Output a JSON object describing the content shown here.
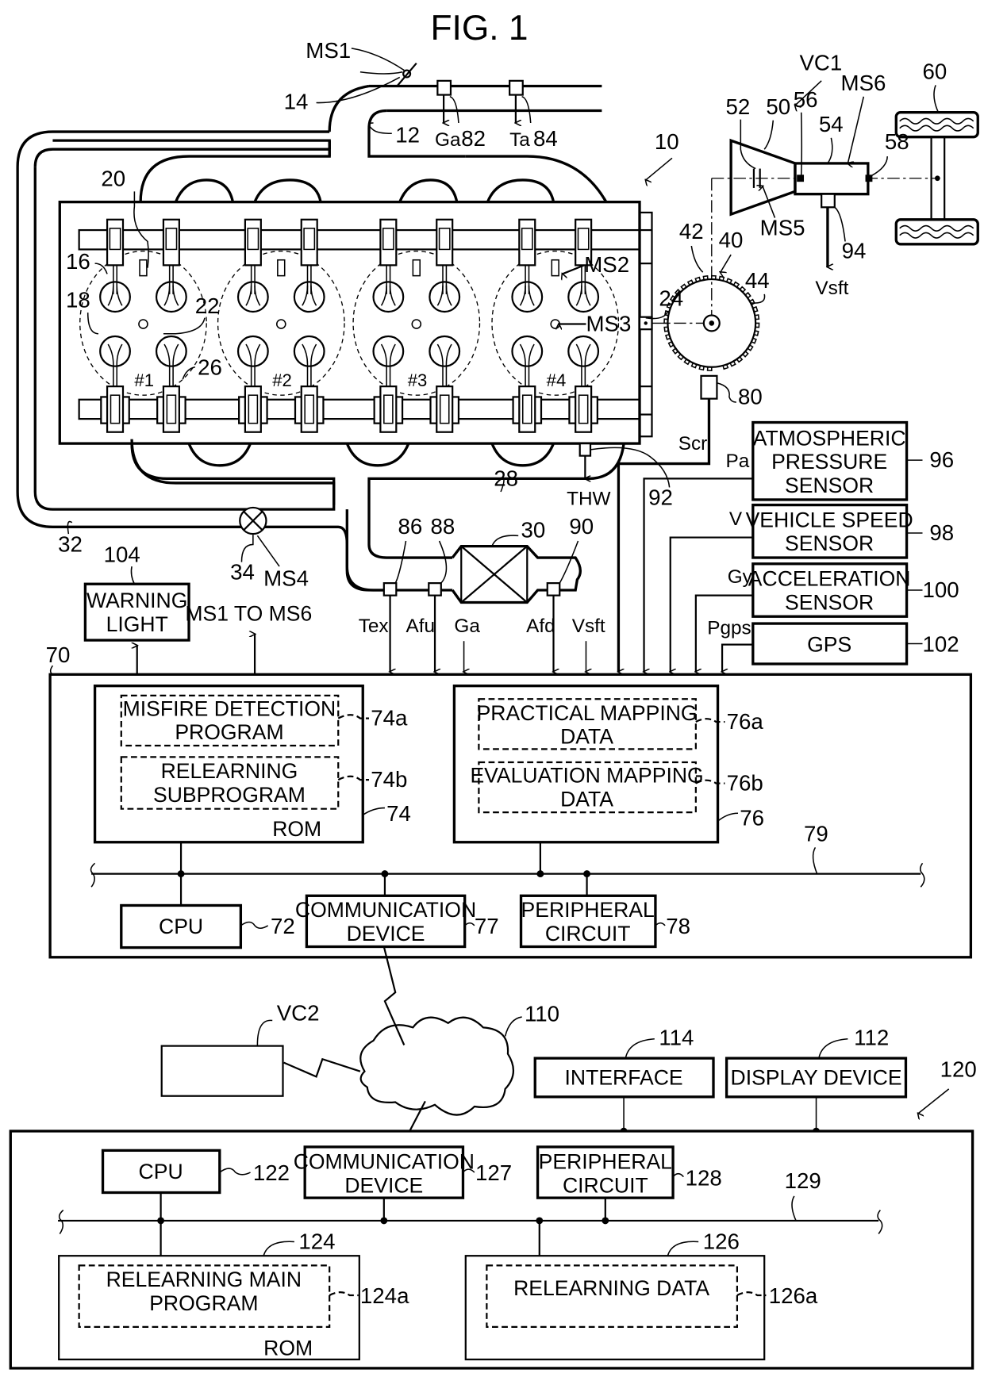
{
  "figure": {
    "title": "FIG. 1"
  },
  "engine": {
    "ref_vehicle": "VC1",
    "ref_engine": "10",
    "ref_intake": "12",
    "ref_throttle": "14",
    "ref_fuel_injector": "16",
    "ref_cylinder": "18",
    "ref_intake_valve": "20",
    "ref_ignition": "22",
    "ref_crankshaft": "24",
    "ref_exhaust_valve": "26",
    "ref_exhaust": "28",
    "ref_catalyst": "30",
    "ref_egr_passage": "32",
    "ref_egr_valve": "34",
    "cylinders": [
      "#1",
      "#2",
      "#3",
      "#4"
    ],
    "ms1": "MS1",
    "ms2": "MS2",
    "ms3": "MS3",
    "ms4": "MS4",
    "ms5": "MS5",
    "ms6": "MS6"
  },
  "drivetrain": {
    "ref_crank_rotor": "40",
    "ref_teeth": "42",
    "ref_missing_tooth": "44",
    "ref_torque_converter": "50",
    "ref_lockup_clutch": "52",
    "ref_transmission": "54",
    "ref_input_shaft": "56",
    "ref_output_shaft": "58",
    "ref_wheels": "60"
  },
  "sensors": {
    "ref_crank_sensor": "80",
    "signal_crank": "Scr",
    "ref_airflow": "82",
    "signal_airflow": "Ga",
    "ref_intake_temp": "84",
    "signal_intake_temp": "Ta",
    "ref_exhaust_temp": "86",
    "signal_exhaust_temp": "Tex",
    "ref_upstream_af": "88",
    "signal_upstream_af": "Afu",
    "ref_downstream_af": "90",
    "signal_downstream_af": "Afd",
    "ref_coolant": "92",
    "signal_coolant": "THW",
    "ref_shaft_speed": "94",
    "signal_shaft_speed": "Vsft",
    "atmospheric": {
      "label_1": "ATMOSPHERIC",
      "label_2": "PRESSURE",
      "label_3": "SENSOR",
      "ref": "96",
      "signal": "Pa"
    },
    "vehicle_speed": {
      "label_1": "VEHICLE SPEED",
      "label_2": "SENSOR",
      "ref": "98",
      "signal": "V"
    },
    "acceleration": {
      "label_1": "ACCELERATION",
      "label_2": "SENSOR",
      "ref": "100",
      "signal": "Gy"
    },
    "gps": {
      "label": "GPS",
      "ref": "102",
      "signal": "Pgps"
    }
  },
  "warning_light": {
    "label_1": "WARNING",
    "label_2": "LIGHT",
    "ref": "104"
  },
  "ecu": {
    "ref": "70",
    "outputs_label": "MS1 TO MS6",
    "cpu": {
      "label": "CPU",
      "ref": "72"
    },
    "rom": {
      "label": "ROM",
      "ref": "74",
      "misfire": {
        "label_1": "MISFIRE DETECTION",
        "label_2": "PROGRAM",
        "ref": "74a"
      },
      "relearn_sub": {
        "label_1": "RELEARNING",
        "label_2": "SUBPROGRAM",
        "ref": "74b"
      }
    },
    "storage": {
      "ref": "76",
      "practical": {
        "label_1": "PRACTICAL MAPPING",
        "label_2": "DATA",
        "ref": "76a"
      },
      "evaluation": {
        "label_1": "EVALUATION MAPPING",
        "label_2": "DATA",
        "ref": "76b"
      }
    },
    "comm": {
      "label_1": "COMMUNICATION",
      "label_2": "DEVICE",
      "ref": "77"
    },
    "peripheral": {
      "label_1": "PERIPHERAL",
      "label_2": "CIRCUIT",
      "ref": "78"
    },
    "bus_ref": "79"
  },
  "network": {
    "ref": "110",
    "other_vehicle": "VC2"
  },
  "data_center": {
    "ref": "120",
    "display": {
      "label": "DISPLAY DEVICE",
      "ref": "112"
    },
    "interface": {
      "label": "INTERFACE",
      "ref": "114"
    },
    "cpu": {
      "label": "CPU",
      "ref": "122"
    },
    "rom": {
      "label": "ROM",
      "ref": "124",
      "main": {
        "label_1": "RELEARNING MAIN",
        "label_2": "PROGRAM",
        "ref": "124a"
      }
    },
    "storage": {
      "ref": "126",
      "data": {
        "label": "RELEARNING DATA",
        "ref": "126a"
      }
    },
    "comm": {
      "label_1": "COMMUNICATION",
      "label_2": "DEVICE",
      "ref": "127"
    },
    "peripheral": {
      "label_1": "PERIPHERAL",
      "label_2": "CIRCUIT",
      "ref": "128"
    },
    "bus_ref": "129"
  }
}
